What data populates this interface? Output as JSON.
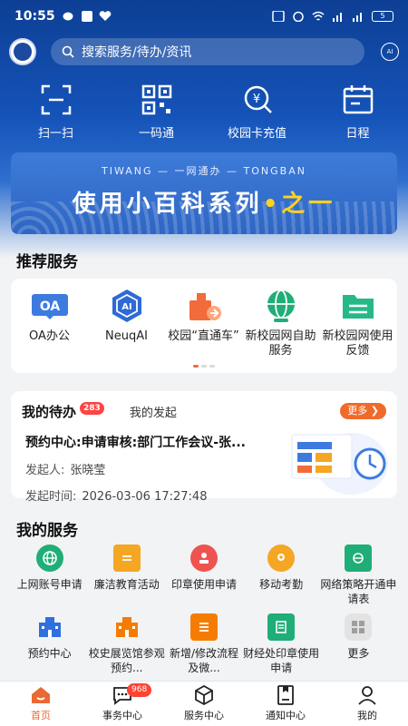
{
  "status_bar": {
    "time": "10:55",
    "battery": "5"
  },
  "header": {
    "search_placeholder": "搜索服务/待办/资讯",
    "quick_actions": [
      {
        "label": "扫一扫",
        "icon": "scan-icon"
      },
      {
        "label": "一码通",
        "icon": "qr-code-icon"
      },
      {
        "label": "校园卡充值",
        "icon": "yuan-card-icon"
      },
      {
        "label": "日程",
        "icon": "calendar-icon"
      }
    ]
  },
  "banner": {
    "subtitle": "TIWANG — 一网通办 — TONGBAN",
    "title_main": "使用小百科系列",
    "title_accent": "•之一"
  },
  "recommended": {
    "title": "推荐服务",
    "items": [
      {
        "label": "OA办公",
        "icon": "oa-icon"
      },
      {
        "label": "NeuqAI",
        "icon": "ai-icon"
      },
      {
        "label": "校园“直通车”",
        "icon": "shuttle-icon"
      },
      {
        "label": "新校园网自助服务",
        "icon": "globe-icon"
      },
      {
        "label": "新校园网使用反馈",
        "icon": "folder-list-icon"
      }
    ]
  },
  "todo": {
    "tab_active": "我的待办",
    "badge": "283",
    "tab_other": "我的发起",
    "more": "更多",
    "item": {
      "title": "预约中心:申请审核:部门工作会议-张...",
      "initiator_label": "发起人:",
      "initiator": "张晓莹",
      "time_label": "发起时间:",
      "time": "2026-03-06 17:27:48"
    }
  },
  "my_services": {
    "title": "我的服务",
    "items": [
      {
        "label": "上网账号申请",
        "icon": "globe-icon",
        "color": "#1fae77"
      },
      {
        "label": "廉洁教育活动",
        "icon": "book-icon",
        "color": "#f5a623"
      },
      {
        "label": "印章使用申请",
        "icon": "stamp-icon",
        "color": "#ef5350"
      },
      {
        "label": "移动考勤",
        "icon": "location-icon",
        "color": "#f5a623"
      },
      {
        "label": "网络策略开通申请表",
        "icon": "book-globe-icon",
        "color": "#1fae77"
      },
      {
        "label": "预约中心",
        "icon": "building-icon",
        "color": "#2f6fe0"
      },
      {
        "label": "校史展览馆参观预约...",
        "icon": "building-icon",
        "color": "#f57c00"
      },
      {
        "label": "新增/修改流程及微...",
        "icon": "list-icon",
        "color": "#f57c00"
      },
      {
        "label": "财经处印章使用申请",
        "icon": "document-icon",
        "color": "#1fae77"
      },
      {
        "label": "更多",
        "icon": "grid-icon",
        "color": "#9e9e9e"
      }
    ]
  },
  "tabbar": {
    "items": [
      {
        "label": "首页",
        "icon": "home-icon"
      },
      {
        "label": "事务中心",
        "icon": "message-icon",
        "badge": "968"
      },
      {
        "label": "服务中心",
        "icon": "cube-icon"
      },
      {
        "label": "通知中心",
        "icon": "notice-icon"
      },
      {
        "label": "我的",
        "icon": "user-icon"
      }
    ]
  }
}
